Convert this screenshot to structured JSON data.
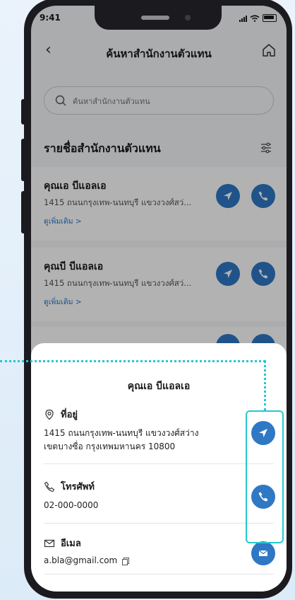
{
  "status": {
    "time": "9:41"
  },
  "header": {
    "title": "ค้นหาสำนักงานตัวแทน"
  },
  "search": {
    "placeholder": "ค้นหาสำนักงานตัวแทน"
  },
  "list": {
    "title": "รายชื่อสำนักงานตัวแทน",
    "items": [
      {
        "name": "คุณเอ บีแอลเอ",
        "address": "1415 ถนนกรุงเทพ-นนทบุรี แขวงวงศ์สว่...",
        "more": "ดูเพิ่มเติม >"
      },
      {
        "name": "คุณบี บีแอลเอ",
        "address": "1415 ถนนกรุงเทพ-นนทบุรี แขวงวงศ์สว่...",
        "more": "ดูเพิ่มเติม >"
      }
    ]
  },
  "detail": {
    "name": "คุณเอ บีแอลเอ",
    "address_label": "ที่อยู่",
    "address_line1": "1415 ถนนกรุงเทพ-นนทบุรี แขวงวงศ์สว่าง",
    "address_line2": "เขตบางซื่อ กรุงเทพมหานคร 10800",
    "phone_label": "โทรศัพท์",
    "phone": "02-000-0000",
    "email_label": "อีเมล",
    "email": "a.bla@gmail.com"
  },
  "colors": {
    "accent": "#2f78c4",
    "highlight": "#25c8cf"
  },
  "icons": [
    "back-icon",
    "home-icon",
    "search-icon",
    "filter-icon",
    "navigate-icon",
    "phone-icon",
    "mail-icon",
    "pin-icon",
    "copy-icon"
  ]
}
